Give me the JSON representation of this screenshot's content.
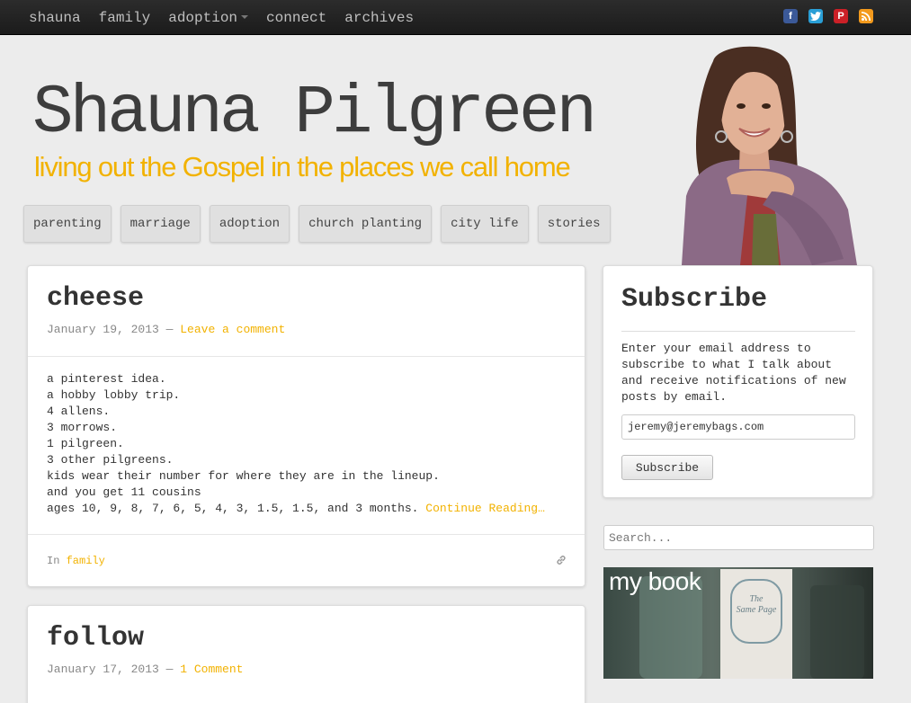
{
  "topnav": {
    "items": [
      "shauna",
      "family",
      "adoption",
      "connect",
      "archives"
    ],
    "social_icons": [
      "facebook-icon",
      "twitter-icon",
      "pinterest-icon",
      "rss-icon"
    ]
  },
  "header": {
    "title": "Shauna Pilgreen",
    "tagline": "living out the Gospel in the places we call home",
    "categories": [
      "parenting",
      "marriage",
      "adoption",
      "church planting",
      "city life",
      "stories"
    ]
  },
  "posts": [
    {
      "title": "cheese",
      "date": "January 19, 2013",
      "sep": " — ",
      "comment_link": "Leave a comment",
      "lines": [
        "a pinterest idea.",
        "a hobby lobby trip.",
        "4 allens.",
        "3 morrows.",
        "1 pilgreen.",
        "3 other pilgreens.",
        "kids wear their number for where they are in the lineup.",
        "and you get 11 cousins",
        "ages 10, 9, 8, 7, 6, 5, 4, 3, 1.5, 1.5, and 3 months."
      ],
      "continue": "Continue Reading…",
      "in_label": "In",
      "category": "family"
    },
    {
      "title": "follow",
      "date": "January 17, 2013",
      "sep": " — ",
      "comment_link": "1 Comment"
    }
  ],
  "sidebar": {
    "subscribe_title": "Subscribe",
    "subscribe_text": "Enter your email address to subscribe to what I talk about and receive notifications of new posts by email.",
    "email_value": "jeremy@jeremybags.com",
    "subscribe_button": "Subscribe",
    "search_placeholder": "Search...",
    "book_label": "my book",
    "book_cover_text": [
      "The",
      "Same Page"
    ]
  },
  "colors": {
    "accent": "#f2b200",
    "topbar": "#1f1f1f",
    "background": "#ececec"
  }
}
